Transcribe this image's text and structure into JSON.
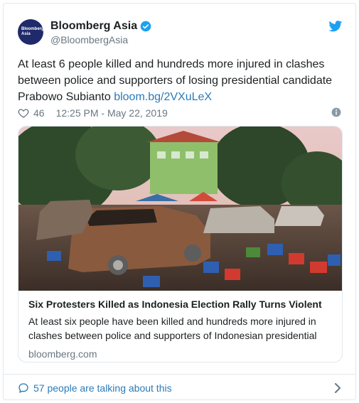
{
  "account": {
    "avatar_text": [
      "Bloomberg",
      "Asia"
    ],
    "display_name": "Bloomberg Asia",
    "handle": "@BloombergAsia"
  },
  "tweet": {
    "text": "At least 6 people killed and hundreds more injured in clashes between police and supporters of losing presidential candidate Prabowo Subianto ",
    "link": "bloom.bg/2VXuLeX",
    "likes": "46",
    "timestamp": "12:25 PM - May 22, 2019"
  },
  "card": {
    "title": "Six Protesters Killed as Indonesia Election Rally Turns Violent",
    "description": "At least six people have been killed and hundreds more injured in clashes between police and supporters of Indonesian presidential",
    "domain": "bloomberg.com"
  },
  "footer": {
    "talking": "57 people are talking about this"
  },
  "colors": {
    "brand_blue": "#1da1f2",
    "link": "#2b7bb9",
    "muted": "#697882",
    "avatar_bg": "#1f2a6b"
  }
}
